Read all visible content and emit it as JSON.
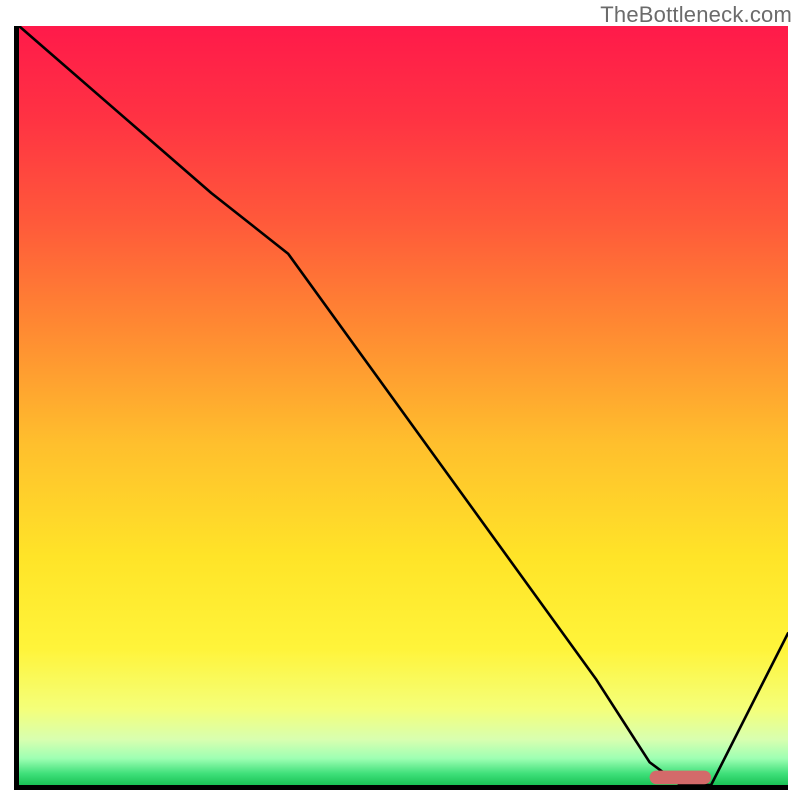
{
  "watermark": "TheBottleneck.com",
  "chart_data": {
    "type": "line",
    "x": [
      0.0,
      0.25,
      0.35,
      0.45,
      0.55,
      0.65,
      0.75,
      0.82,
      0.86,
      0.9,
      1.0
    ],
    "values": [
      1.0,
      0.78,
      0.7,
      0.56,
      0.42,
      0.28,
      0.14,
      0.03,
      0.0,
      0.0,
      0.2
    ],
    "title": "",
    "xlabel": "",
    "ylabel": "",
    "xlim": [
      0,
      1
    ],
    "ylim": [
      0,
      1
    ],
    "marker_segment": {
      "x0": 0.82,
      "x1": 0.9,
      "y": 0.01
    },
    "background_gradient": {
      "stops": [
        {
          "offset": 0.0,
          "color": "#ff1a4a"
        },
        {
          "offset": 0.12,
          "color": "#ff3243"
        },
        {
          "offset": 0.26,
          "color": "#ff5a3a"
        },
        {
          "offset": 0.4,
          "color": "#ff8a32"
        },
        {
          "offset": 0.55,
          "color": "#ffbf2d"
        },
        {
          "offset": 0.7,
          "color": "#ffe428"
        },
        {
          "offset": 0.82,
          "color": "#fff43a"
        },
        {
          "offset": 0.9,
          "color": "#f4ff7a"
        },
        {
          "offset": 0.94,
          "color": "#d8ffb0"
        },
        {
          "offset": 0.965,
          "color": "#9effb3"
        },
        {
          "offset": 0.985,
          "color": "#3fe07a"
        },
        {
          "offset": 1.0,
          "color": "#19c255"
        }
      ]
    },
    "marker_color": "#d36a6a",
    "line_color": "#000000",
    "line_width": 3.4
  }
}
